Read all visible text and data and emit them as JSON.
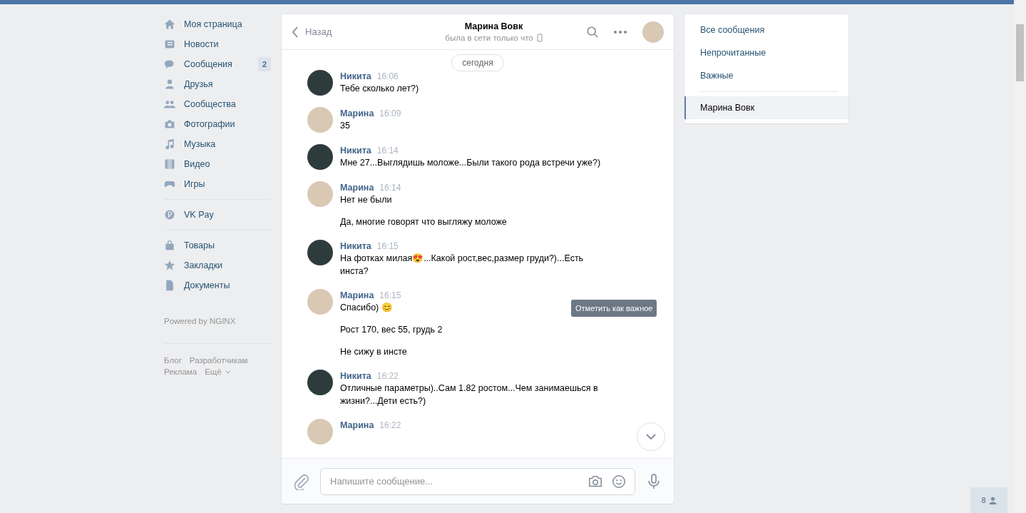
{
  "nav": {
    "groups": [
      [
        {
          "label": "Моя страница"
        },
        {
          "label": "Новости"
        },
        {
          "label": "Сообщения",
          "count": "2"
        },
        {
          "label": "Друзья"
        },
        {
          "label": "Сообщества"
        },
        {
          "label": "Фотографии"
        },
        {
          "label": "Музыка"
        },
        {
          "label": "Видео"
        },
        {
          "label": "Игры"
        }
      ],
      [
        {
          "label": "VK Pay"
        }
      ],
      [
        {
          "label": "Товары"
        },
        {
          "label": "Закладки"
        },
        {
          "label": "Документы"
        }
      ]
    ],
    "powered": "Powered by NGINX",
    "footer_links": [
      "Блог",
      "Разработчикам",
      "Реклама",
      "Ещё"
    ]
  },
  "chat": {
    "back": "Назад",
    "title": "Марина Вовк",
    "status": "была в сети только что",
    "date": "сегодня",
    "messages": [
      {
        "author": "Никита",
        "time": "16:06",
        "color": "#2e3b3c",
        "texts": [
          "Тебе сколько лет?)"
        ]
      },
      {
        "author": "Марина",
        "time": "16:09",
        "color": "#d9c8b4",
        "texts": [
          "35"
        ]
      },
      {
        "author": "Никита",
        "time": "16:14",
        "color": "#2e3b3c",
        "texts": [
          "Мне 27...Выглядишь моложе...Были такого рода встречи уже?)"
        ]
      },
      {
        "author": "Марина",
        "time": "16:14",
        "color": "#d9c8b4",
        "texts": [
          "Нет не были",
          "Да, многие говорят что выгляжу моложе"
        ]
      },
      {
        "author": "Никита",
        "time": "16:15",
        "color": "#2e3b3c",
        "texts": [
          "На фотках милая😍...Какой рост,вес,размер груди?)...Есть инста?"
        ]
      },
      {
        "author": "Марина",
        "time": "16:15",
        "color": "#d9c8b4",
        "texts": [
          "Спасибо) 😊",
          "Рост 170, вес 55, грудь 2",
          "Не сижу в инсте"
        ]
      },
      {
        "author": "Никита",
        "time": "16:22",
        "color": "#2e3b3c",
        "texts": [
          "Отличные параметры)..Сам 1.82 ростом...Чем занимаешься в жизни?...Дети есть?)"
        ]
      },
      {
        "author": "Марина",
        "time": "16:22",
        "color": "#d9c8b4"
      }
    ],
    "tooltip": "Отметить как важное",
    "placeholder": "Напишите сообщение..."
  },
  "filters": [
    {
      "label": "Все сообщения",
      "selected": false
    },
    {
      "label": "Непрочитанные",
      "selected": false
    },
    {
      "label": "Важные",
      "selected": false
    }
  ],
  "conversations": [
    {
      "label": "Марина Вовк",
      "selected": true
    }
  ],
  "online_friends": {
    "count": "8"
  }
}
